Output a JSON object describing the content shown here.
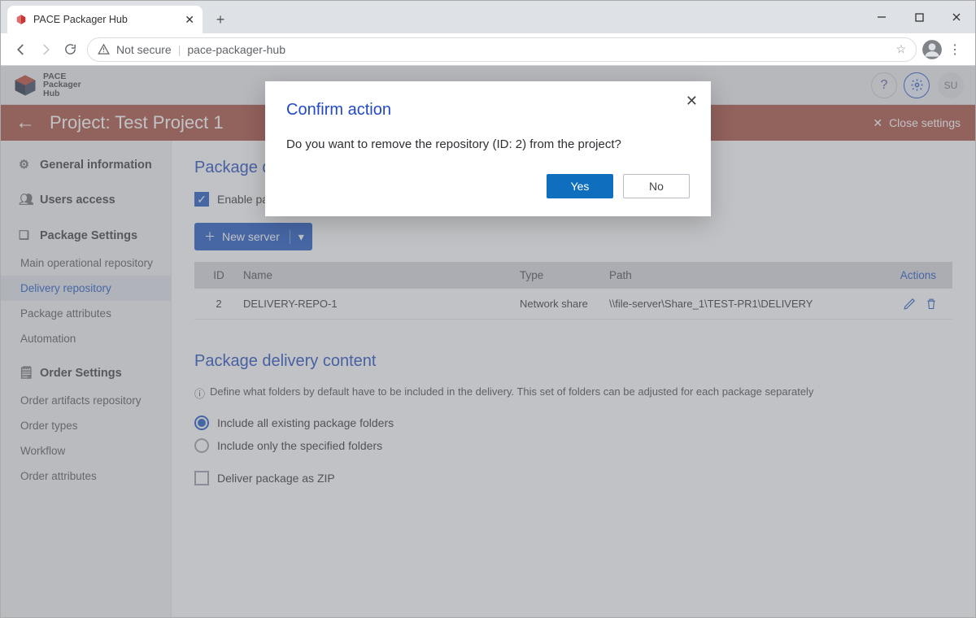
{
  "browser": {
    "tab_title": "PACE Packager Hub",
    "security_label": "Not secure",
    "url": "pace-packager-hub"
  },
  "brand": {
    "l1": "PACE",
    "l2": "Packager",
    "l3": "Hub",
    "su": "SU"
  },
  "redbar": {
    "back": "←",
    "title": "Project: Test Project 1",
    "close": "Close settings"
  },
  "sidebar": {
    "general": "General information",
    "users": "Users access",
    "pkg_settings": "Package Settings",
    "items_pkg": [
      "Main operational repository",
      "Delivery repository",
      "Package attributes",
      "Automation"
    ],
    "order_settings": "Order Settings",
    "items_ord": [
      "Order artifacts repository",
      "Order types",
      "Workflow",
      "Order attributes"
    ]
  },
  "content": {
    "title1": "Package delivery repository",
    "cb_enable": "Enable package delivery",
    "new_server": "New server",
    "table": {
      "headers": {
        "id": "ID",
        "name": "Name",
        "type": "Type",
        "path": "Path",
        "actions": "Actions"
      },
      "rows": [
        {
          "id": "2",
          "name": "DELIVERY-REPO-1",
          "type": "Network share",
          "path": "\\\\file-server\\Share_1\\TEST-PR1\\DELIVERY"
        }
      ]
    },
    "title2": "Package delivery content",
    "hint": "Define what folders by default have to be included in the delivery. This set of folders can be adjusted for each package separately",
    "radio1": "Include all existing package folders",
    "radio2": "Include only the specified folders",
    "cb_zip": "Deliver package as ZIP"
  },
  "modal": {
    "title": "Confirm action",
    "body": "Do you want to remove the repository (ID: 2) from the project?",
    "yes": "Yes",
    "no": "No"
  }
}
